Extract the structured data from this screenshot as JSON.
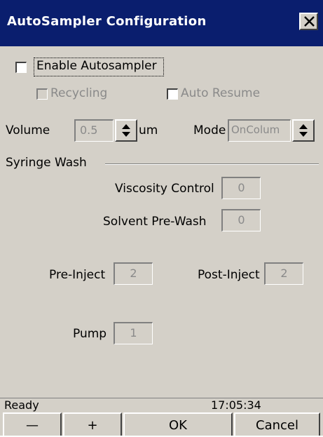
{
  "window": {
    "title": "AutoSampler Configuration"
  },
  "enable_autosampler": {
    "label": "Enable Autosampler",
    "checked": false
  },
  "recycling": {
    "label": "Recycling",
    "checked": false,
    "enabled": false
  },
  "auto_resume": {
    "label": "Auto Resume",
    "checked": false,
    "enabled": false
  },
  "volume": {
    "label": "Volume",
    "value": "0.5",
    "unit": "um"
  },
  "mode": {
    "label": "Mode",
    "value": "OnColum"
  },
  "syringe_wash": {
    "group_label": "Syringe Wash",
    "viscosity_control": {
      "label": "Viscosity Control",
      "value": "0"
    },
    "solvent_pre_wash": {
      "label": "Solvent Pre-Wash",
      "value": "0"
    },
    "pre_inject": {
      "label": "Pre-Inject",
      "value": "2"
    },
    "post_inject": {
      "label": "Post-Inject",
      "value": "2"
    },
    "pump": {
      "label": "Pump",
      "value": "1"
    }
  },
  "status": {
    "text": "Ready",
    "time": "17:05:34"
  },
  "buttons": {
    "minus": "—",
    "plus": "+",
    "ok": "OK",
    "cancel": "Cancel"
  },
  "colors": {
    "titlebar": "#0a1e6e",
    "dialog_background": "#d4d0c8",
    "disabled_text": "#8a8a8a"
  },
  "icons": {
    "close": "close-x-icon",
    "spinner": "up-down-arrows-icon"
  }
}
